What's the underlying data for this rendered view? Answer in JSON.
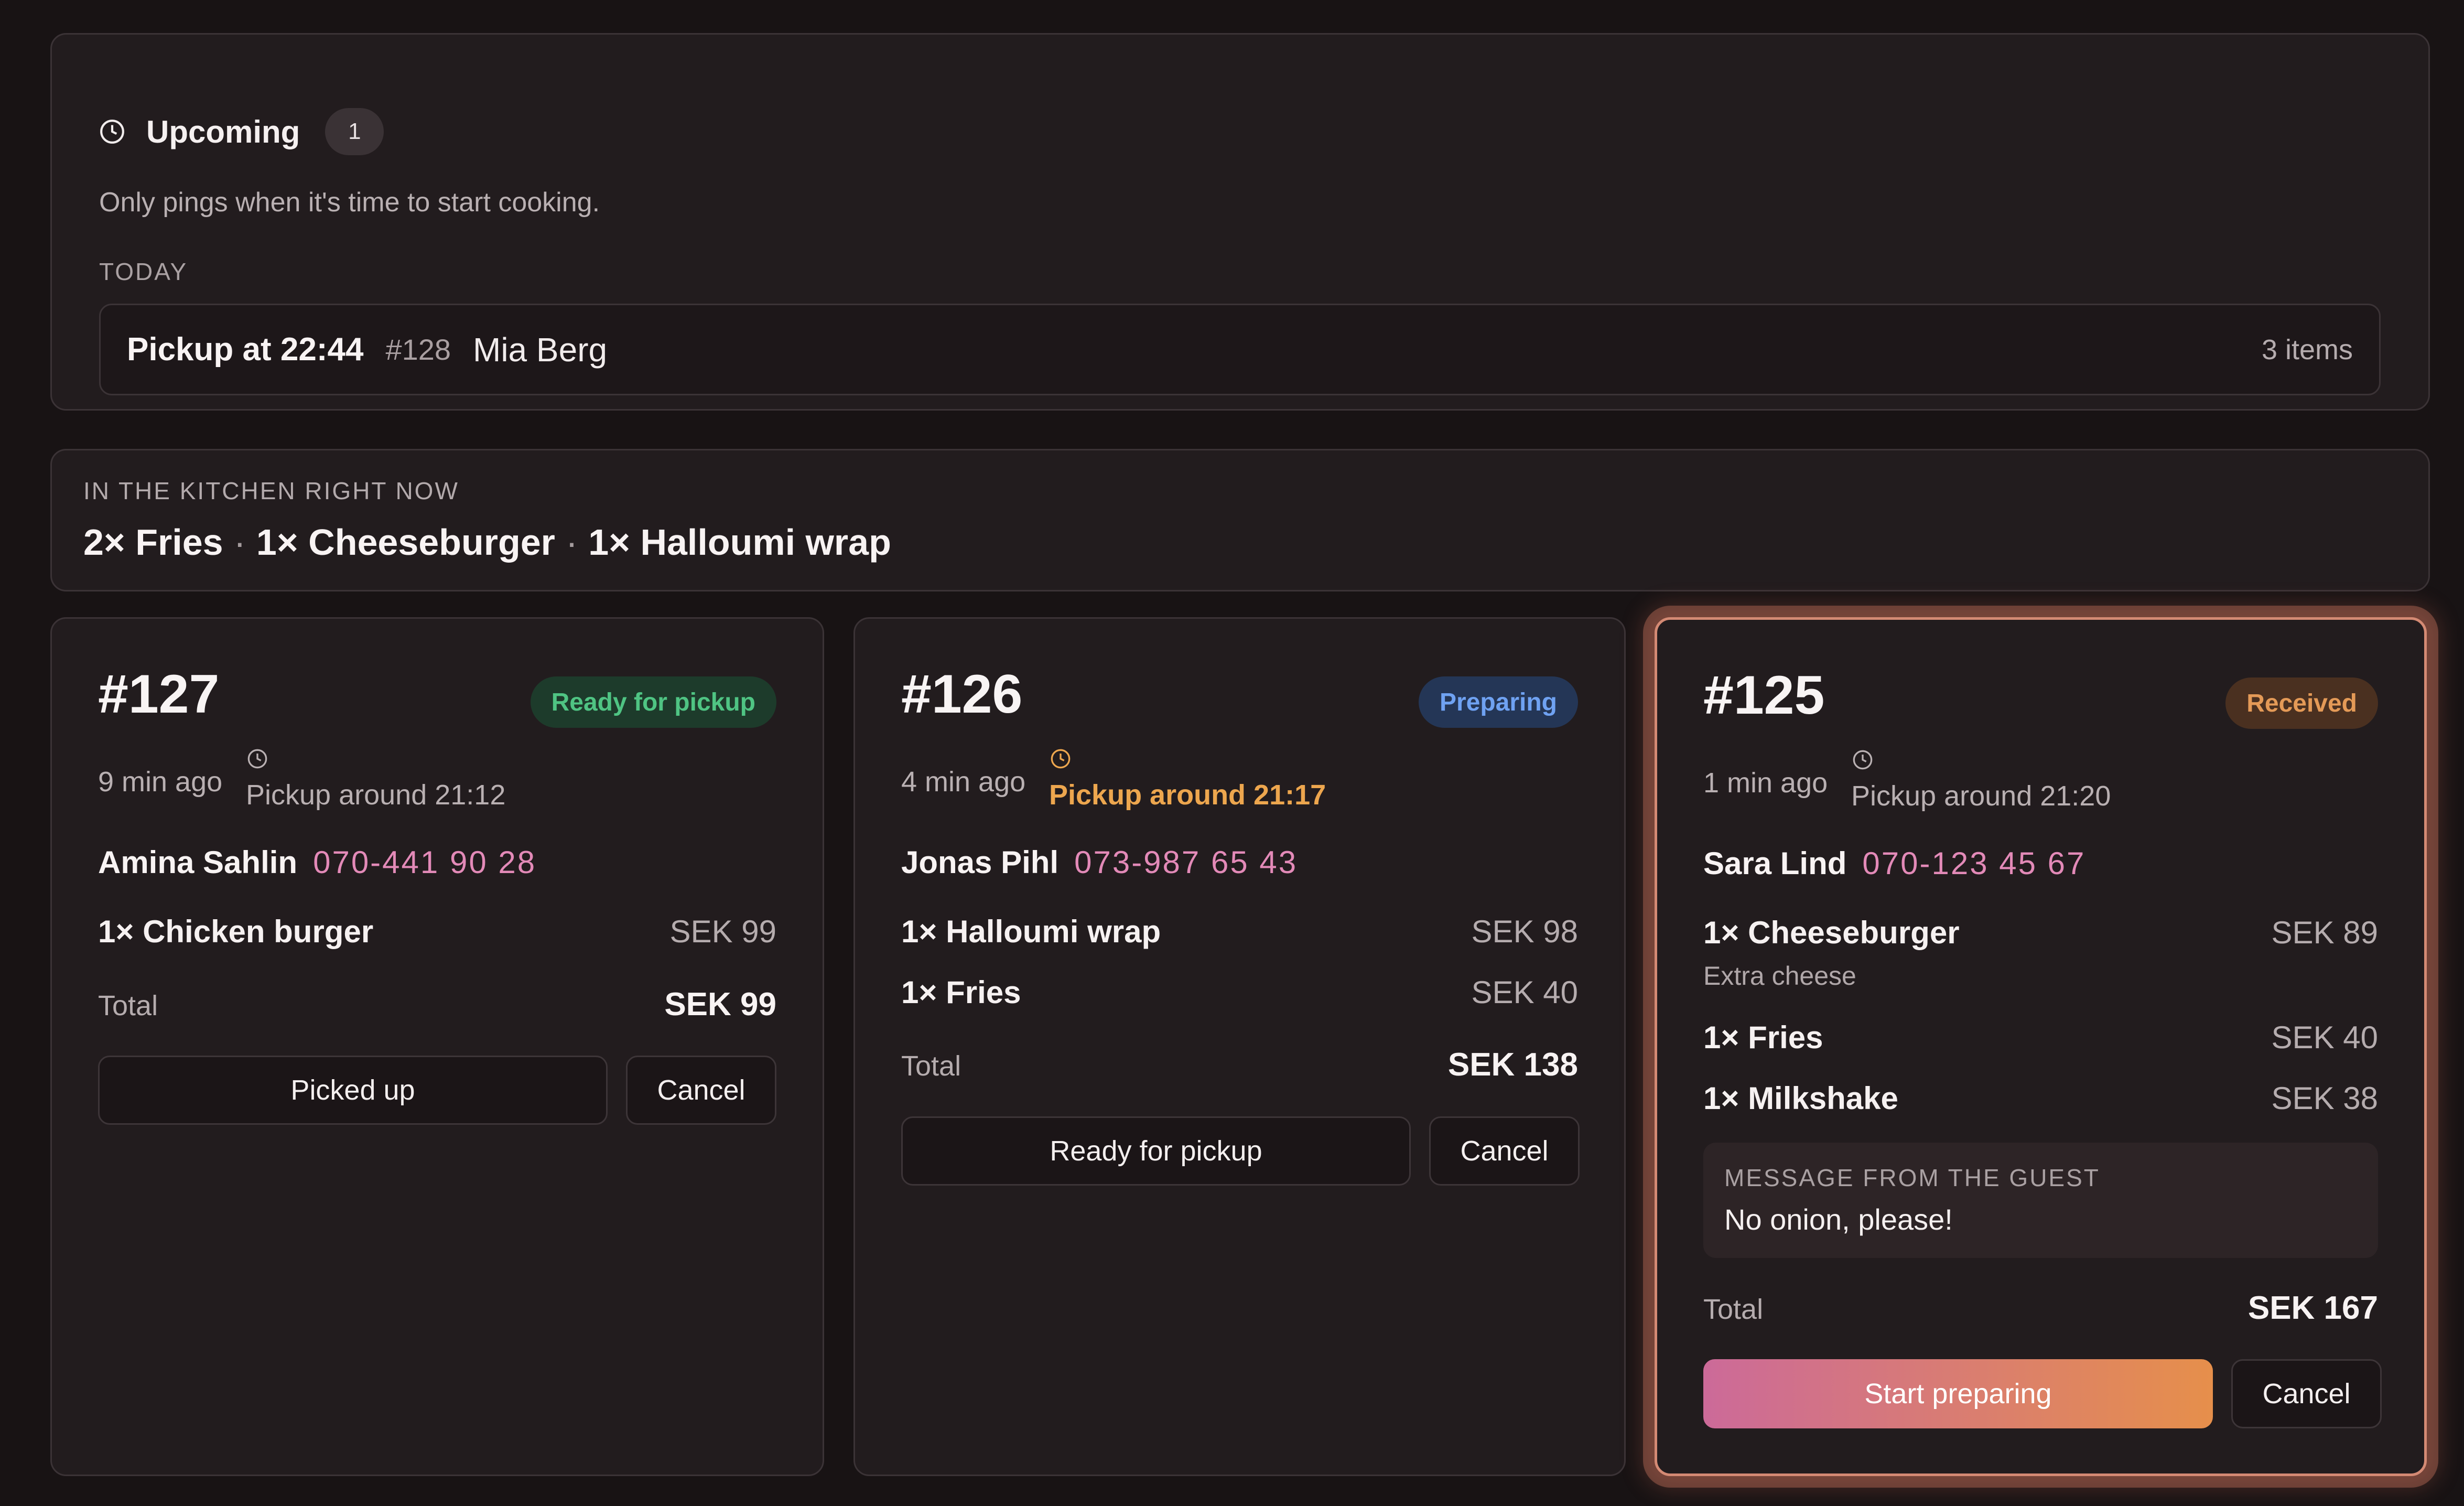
{
  "upcoming": {
    "title": "Upcoming",
    "count": "1",
    "subtitle": "Only pings when it's time to start cooking.",
    "group_label": "TODAY",
    "orders": [
      {
        "pickup": "Pickup at 22:44",
        "number": "#128",
        "name": "Mia Berg",
        "items": "3 items"
      }
    ]
  },
  "kitchen": {
    "label": "IN THE KITCHEN RIGHT NOW",
    "items": [
      "2× Fries",
      "1× Cheeseburger",
      "1× Halloumi wrap"
    ],
    "separator": "·"
  },
  "orders": [
    {
      "number": "#127",
      "status": "Ready for pickup",
      "ago": "9 min ago",
      "pickup": "Pickup around 21:12",
      "customer": "Amina Sahlin",
      "phone": "070-441 90 28",
      "items": [
        {
          "name": "1× Chicken burger",
          "price": "SEK 99"
        }
      ],
      "total_label": "Total",
      "total": "SEK 99",
      "primary_action": "Picked up",
      "cancel": "Cancel"
    },
    {
      "number": "#126",
      "status": "Preparing",
      "ago": "4 min ago",
      "pickup": "Pickup around 21:17",
      "customer": "Jonas Pihl",
      "phone": "073-987 65 43",
      "items": [
        {
          "name": "1× Halloumi wrap",
          "price": "SEK 98"
        },
        {
          "name": "1× Fries",
          "price": "SEK 40"
        }
      ],
      "total_label": "Total",
      "total": "SEK 138",
      "primary_action": "Ready for pickup",
      "cancel": "Cancel"
    },
    {
      "number": "#125",
      "status": "Received",
      "ago": "1 min ago",
      "pickup": "Pickup around 21:20",
      "customer": "Sara Lind",
      "phone": "070-123 45 67",
      "items": [
        {
          "name": "1× Cheeseburger",
          "price": "SEK 89",
          "note": "Extra cheese"
        },
        {
          "name": "1× Fries",
          "price": "SEK 40"
        },
        {
          "name": "1× Milkshake",
          "price": "SEK 38"
        }
      ],
      "message_label": "MESSAGE FROM THE GUEST",
      "message": "No onion, please!",
      "total_label": "Total",
      "total": "SEK 167",
      "primary_action": "Start preparing",
      "cancel": "Cancel"
    }
  ],
  "colors": {
    "background": "#181314",
    "panel": "#221c1e",
    "ready": "#4fc483",
    "preparing": "#6fa2f2",
    "received": "#e49a57",
    "phone": "#e38ab8",
    "late_pickup": "#eda64e",
    "highlight_border": "#d48a74"
  },
  "icons": {
    "clock": "clock-icon"
  }
}
